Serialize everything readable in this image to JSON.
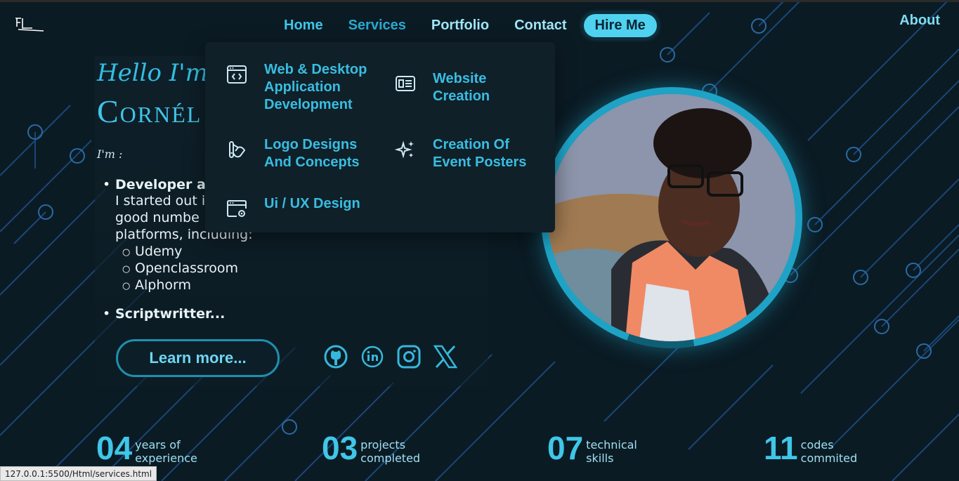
{
  "nav": {
    "items": [
      {
        "label": "Home"
      },
      {
        "label": "Services"
      },
      {
        "label": "Portfolio"
      },
      {
        "label": "Contact"
      }
    ],
    "hire_label": "Hire Me",
    "about_label": "About"
  },
  "hero": {
    "greeting": "Hello I'm",
    "name": "Cornél",
    "im_label": "I'm :",
    "role1_title": "Developer ar",
    "role1_desc_1": "I started out i",
    "role1_desc_2": "good numbe",
    "role1_desc_3": "platforms, including:",
    "platforms": [
      "Udemy",
      "Openclassroom",
      "Alphorm"
    ],
    "role2_title": "Scriptwritter...",
    "learn_more": "Learn more..."
  },
  "services_menu": {
    "items": [
      {
        "label_1": "Web & Desktop",
        "label_2": "Application",
        "label_3": "Development",
        "icon": "code-window-icon"
      },
      {
        "label_1": "Website",
        "label_2": "Creation",
        "icon": "website-layout-icon"
      },
      {
        "label_1": "Logo Designs",
        "label_2": "And Concepts",
        "icon": "palette-icon"
      },
      {
        "label_1": "Creation Of",
        "label_2": "Event Posters",
        "icon": "sparkles-icon"
      },
      {
        "label_1": "Ui / UX Design",
        "icon": "settings-window-icon"
      }
    ]
  },
  "socials": [
    "github-icon",
    "linkedin-icon",
    "instagram-icon",
    "x-icon"
  ],
  "stats": [
    {
      "value": "04",
      "line1": "years of",
      "line2": "experience"
    },
    {
      "value": "03",
      "line1": "projects",
      "line2": "completed"
    },
    {
      "value": "07",
      "line1": "technical",
      "line2": "skills"
    },
    {
      "value": "11",
      "line1": "codes",
      "line2": "commited"
    }
  ],
  "status_url": "127.0.0.1:5500/Html/services.html",
  "colors": {
    "accent": "#3fc6e8",
    "background": "#0b1b24",
    "hire_button": "#4fd2f0"
  }
}
